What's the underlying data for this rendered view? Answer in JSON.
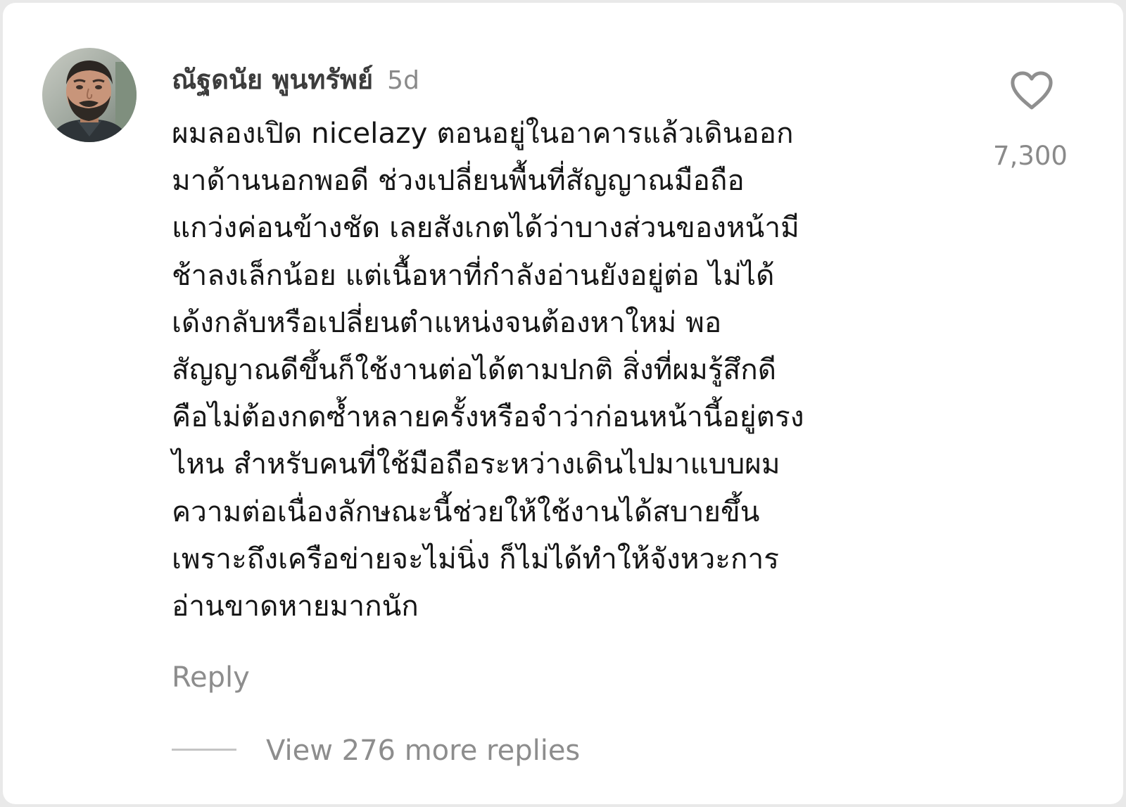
{
  "comment": {
    "author": "ณัฐดนัย พูนทรัพย์",
    "timestamp": "5d",
    "avatar": "user-avatar-photo",
    "body_lines": [
      "ผมลองเปิด nicelazy ตอนอยู่ในอาคารแล้วเดินออก",
      "มาด้านนอกพอดี ช่วงเปลี่ยนพื้นที่สัญญาณมือถือ",
      "แกว่งค่อนข้างชัด เลยสังเกตได้ว่าบางส่วนของหน้ามี",
      "ช้าลงเล็กน้อย แต่เนื้อหาที่กำลังอ่านยังอยู่ต่อ ไม่ได้",
      "เด้งกลับหรือเปลี่ยนตำแหน่งจนต้องหาใหม่ พอ",
      "สัญญาณดีขึ้นก็ใช้งานต่อได้ตามปกติ สิ่งที่ผมรู้สึกดี",
      "คือไม่ต้องกดซ้ำหลายครั้งหรือจำว่าก่อนหน้านี้อยู่ตรง",
      "ไหน สำหรับคนที่ใช้มือถือระหว่างเดินไปมาแบบผม",
      "ความต่อเนื่องลักษณะนี้ช่วยให้ใช้งานได้สบายขึ้น",
      "เพราะถึงเครือข่ายจะไม่นิ่ง ก็ไม่ได้ทำให้จังหวะการ",
      "อ่านขาดหายมากนัก"
    ],
    "like_icon": "heart-outline-icon",
    "like_count": "7,300",
    "reply_label": "Reply",
    "view_replies_label": "View 276 more replies"
  },
  "colors": {
    "background": "#ffffff",
    "body_text": "#161616",
    "muted_text": "#8d8d8d",
    "username_text": "#3c3c3c"
  }
}
